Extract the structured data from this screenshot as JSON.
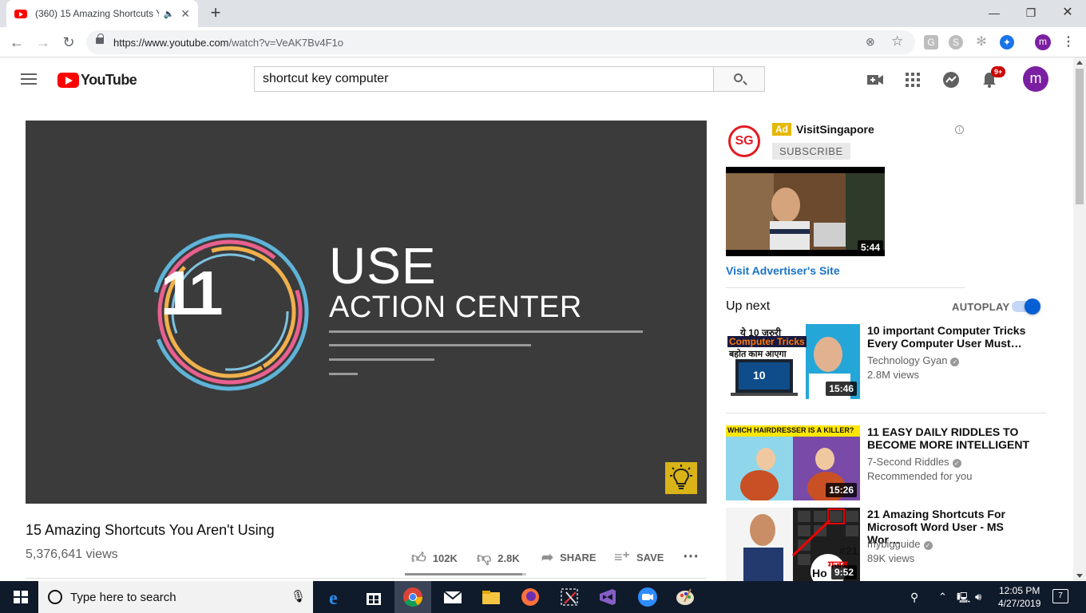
{
  "browser": {
    "tab_title": "(360) 15 Amazing Shortcuts Y",
    "url_host": "https://www.youtube.com",
    "url_path": "/watch?v=VeAK7Bv4F1o",
    "profile_initial": "m"
  },
  "header": {
    "logo_text": "YouTube",
    "search_value": "shortcut key computer",
    "notification_count": "9+",
    "avatar_initial": "m"
  },
  "player": {
    "number": "11",
    "heading_line1": "USE",
    "heading_line2": "ACTION CENTER"
  },
  "video": {
    "title": "15 Amazing Shortcuts You Aren't Using",
    "views": "5,376,641 views",
    "likes": "102K",
    "dislikes": "2.8K",
    "share_label": "SHARE",
    "save_label": "SAVE",
    "like_ratio": 0.97
  },
  "ad": {
    "logo_text": "SG",
    "tag": "Ad",
    "name": "VisitSingapore",
    "subscribe_label": "SUBSCRIBE",
    "duration": "5:44",
    "visit_label": "Visit Advertiser's Site"
  },
  "upnext": {
    "label": "Up next",
    "autoplay_label": "AUTOPLAY",
    "autoplay_on": true
  },
  "recommendations": [
    {
      "title": "10 important Computer Tricks Every Computer User Must…",
      "channel": "Technology Gyan",
      "meta": "2.8M views",
      "duration": "15:46",
      "thumb_line1": "ये 10 जरुरी",
      "thumb_line2": "Computer Tricks",
      "thumb_line3": "बहोत काम आएगा",
      "thumb_screen": "10"
    },
    {
      "title": "11 EASY DAILY RIDDLES TO BECOME MORE INTELLIGENT",
      "channel": "7-Second Riddles",
      "meta": "Recommended for you",
      "duration": "15:26",
      "thumb_line1": "WHICH HAIRDRESSER IS A KILLER?"
    },
    {
      "title": "21 Amazing Shortcuts For Microsoft Word User - MS Wor…",
      "channel": "mybigguide",
      "meta": "89K views",
      "duration": "9:52",
      "thumb_line1": "#21",
      "thumb_line2": "गजब",
      "thumb_line3": "Ho"
    }
  ],
  "taskbar": {
    "search_placeholder": "Type here to search",
    "time": "12:05 PM",
    "date": "4/27/2019",
    "notification_count": "7"
  }
}
